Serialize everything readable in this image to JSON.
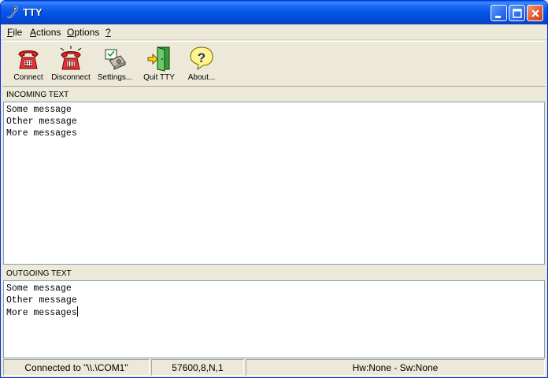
{
  "window": {
    "title": "TTY"
  },
  "menu": [
    {
      "label": "File",
      "accel": "F",
      "rest": "ile"
    },
    {
      "label": "Actions",
      "accel": "A",
      "rest": "ctions"
    },
    {
      "label": "Options",
      "accel": "O",
      "rest": "ptions"
    },
    {
      "label": "?",
      "accel": "?",
      "rest": ""
    }
  ],
  "toolbar": [
    {
      "label": "Connect",
      "icon": "phone-icon"
    },
    {
      "label": "Disconnect",
      "icon": "phone-ringing-icon"
    },
    {
      "label": "Settings...",
      "icon": "settings-icon"
    },
    {
      "label": "Quit TTY",
      "icon": "exit-door-icon"
    },
    {
      "label": "About...",
      "icon": "help-icon"
    }
  ],
  "incoming": {
    "header": "INCOMING TEXT",
    "lines": [
      "Some message",
      "Other message",
      "More messages"
    ]
  },
  "outgoing": {
    "header": "OUTGOING TEXT",
    "lines": [
      "Some message",
      "Other message",
      "More messages"
    ]
  },
  "status": {
    "connection": "Connected to \"\\\\.\\COM1\"",
    "settings": "57600,8,N,1",
    "flow": "Hw:None - Sw:None"
  },
  "colors": {
    "title_bar": "#0455E8",
    "close_button": "#E25B32",
    "frame": "#ECE9D8"
  }
}
